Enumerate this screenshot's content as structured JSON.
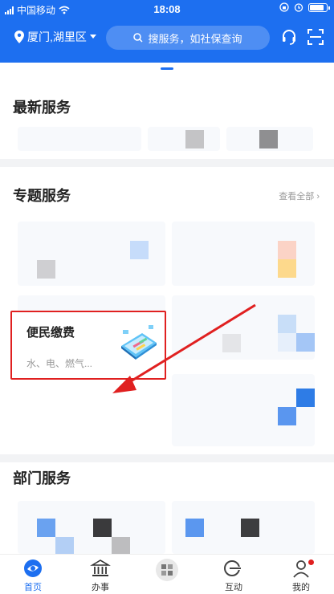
{
  "status_bar": {
    "carrier": "中国移动",
    "time": "18:08"
  },
  "header": {
    "location": "厦门,湖里区",
    "search_placeholder": "搜服务，如社保查询"
  },
  "sections": {
    "latest": {
      "title": "最新服务"
    },
    "topics": {
      "title": "专题服务",
      "view_all": "查看全部"
    },
    "highlight_card": {
      "title": "便民缴费",
      "subtitle": "水、电、燃气..."
    },
    "departments": {
      "title": "部门服务"
    }
  },
  "tabs": [
    {
      "label": "首页",
      "icon": "home-icon",
      "active": true
    },
    {
      "label": "办事",
      "icon": "bank-icon"
    },
    {
      "label": "",
      "icon": "center-logo-icon"
    },
    {
      "label": "互动",
      "icon": "12345-icon"
    },
    {
      "label": "我的",
      "icon": "user-icon"
    }
  ],
  "colors": {
    "accent": "#1d6ff0",
    "highlight_border": "#e02020",
    "arrow": "#e02020"
  }
}
